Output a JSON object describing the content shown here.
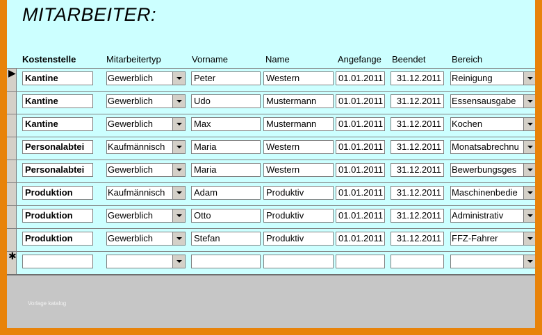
{
  "form": {
    "title": "MITARBEITER:",
    "watermark": "Vorlage katalog"
  },
  "columns": {
    "kostenstelle": "Kostenstelle",
    "mitarbeitertyp": "Mitarbeitertyp",
    "vorname": "Vorname",
    "name": "Name",
    "angefange": "Angefange",
    "beendet": "Beendet",
    "bereich": "Bereich"
  },
  "record_selector": {
    "current_glyph": "▶",
    "new_glyph": "✱"
  },
  "rows": [
    {
      "kostenstelle": "Kantine",
      "typ": "Gewerblich",
      "vorname": "Peter",
      "name": "Western",
      "start": "01.01.2011",
      "end": "31.12.2011",
      "bereich": "Reinigung"
    },
    {
      "kostenstelle": "Kantine",
      "typ": "Gewerblich",
      "vorname": "Udo",
      "name": "Mustermann",
      "start": "01.01.2011",
      "end": "31.12.2011",
      "bereich": "Essensausgabe"
    },
    {
      "kostenstelle": "Kantine",
      "typ": "Gewerblich",
      "vorname": "Max",
      "name": "Mustermann",
      "start": "01.01.2011",
      "end": "31.12.2011",
      "bereich": "Kochen"
    },
    {
      "kostenstelle": "Personalabtei",
      "typ": "Kaufmännisch",
      "vorname": "Maria",
      "name": "Western",
      "start": "01.01.2011",
      "end": "31.12.2011",
      "bereich": "Monatsabrechnu"
    },
    {
      "kostenstelle": "Personalabtei",
      "typ": "Gewerblich",
      "vorname": "Maria",
      "name": "Western",
      "start": "01.01.2011",
      "end": "31.12.2011",
      "bereich": "Bewerbungsges"
    },
    {
      "kostenstelle": "Produktion",
      "typ": "Kaufmännisch",
      "vorname": "Adam",
      "name": "Produktiv",
      "start": "01.01.2011",
      "end": "31.12.2011",
      "bereich": "Maschinenbedie"
    },
    {
      "kostenstelle": "Produktion",
      "typ": "Gewerblich",
      "vorname": "Otto",
      "name": "Produktiv",
      "start": "01.01.2011",
      "end": "31.12.2011",
      "bereich": "Administrativ"
    },
    {
      "kostenstelle": "Produktion",
      "typ": "Gewerblich",
      "vorname": "Stefan",
      "name": "Produktiv",
      "start": "01.01.2011",
      "end": "31.12.2011",
      "bereich": "FFZ-Fahrer"
    },
    {
      "kostenstelle": "",
      "typ": "",
      "vorname": "",
      "name": "",
      "start": "",
      "end": "",
      "bereich": ""
    }
  ]
}
